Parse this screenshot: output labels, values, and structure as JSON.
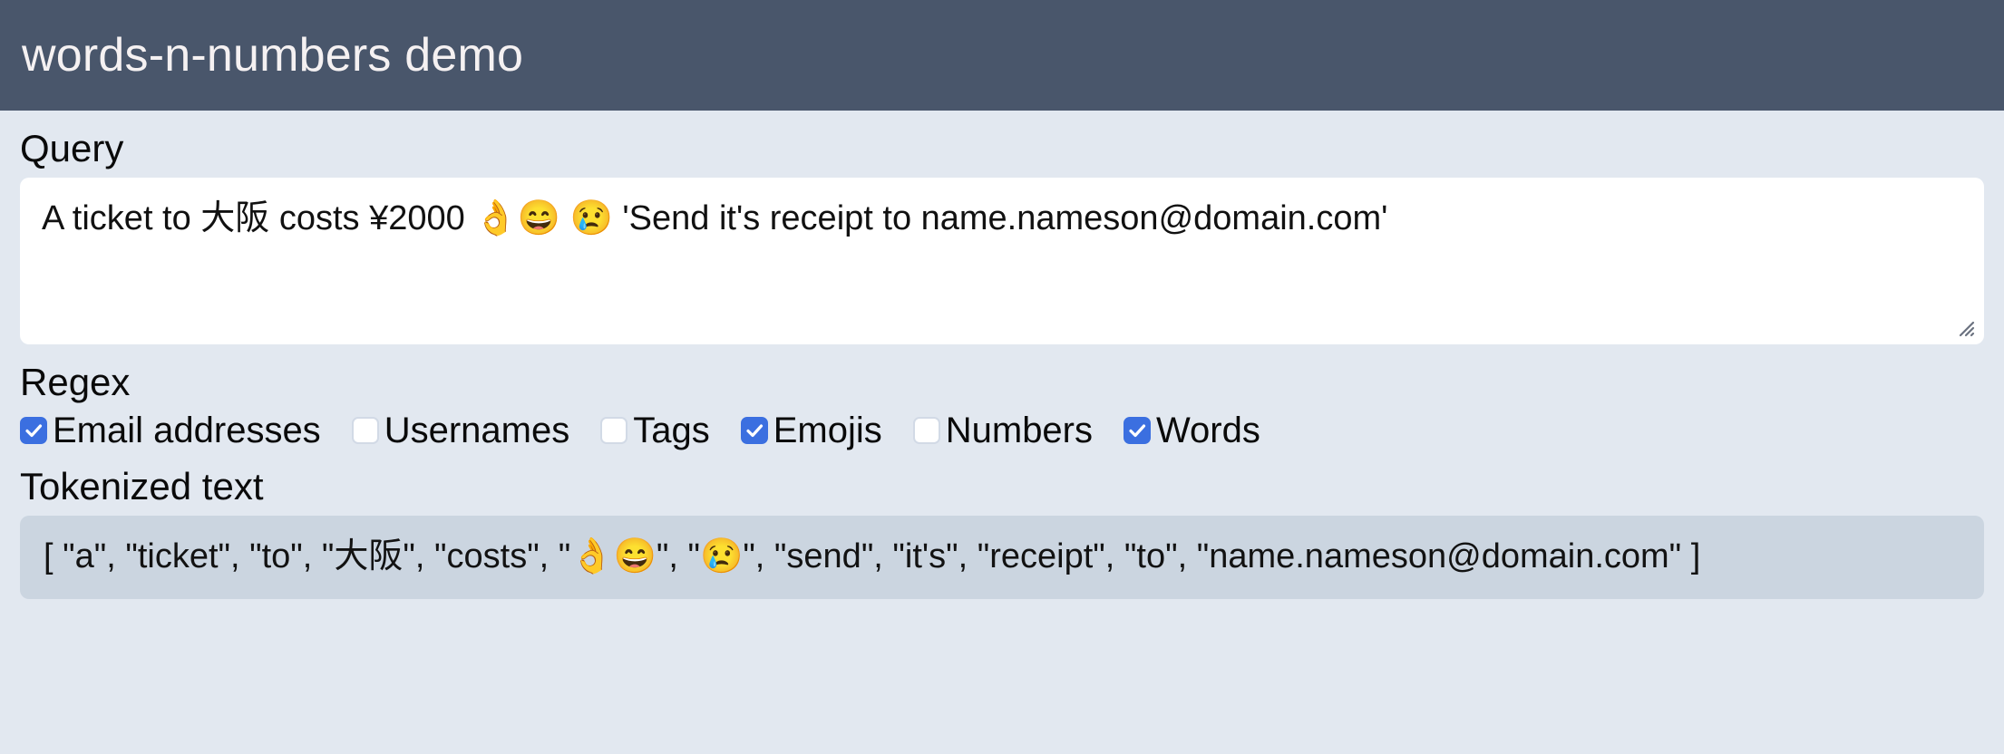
{
  "header": {
    "title": "words-n-numbers demo",
    "background_color": "#49566b",
    "text_color": "#f5f1f2"
  },
  "theme": {
    "page_background": "#e2e8f0",
    "accent_color": "#3b6fe0",
    "output_background": "#cbd5e0",
    "input_background": "#ffffff"
  },
  "query": {
    "label": "Query",
    "value": "A ticket to 大阪 costs ¥2000 👌😄 😢 'Send it's receipt to name.nameson@domain.com'",
    "placeholder": "Type a query..."
  },
  "regex": {
    "label": "Regex",
    "options": [
      {
        "label": "Email addresses",
        "checked": true
      },
      {
        "label": "Usernames",
        "checked": false
      },
      {
        "label": "Tags",
        "checked": false
      },
      {
        "label": "Emojis",
        "checked": true
      },
      {
        "label": "Numbers",
        "checked": false
      },
      {
        "label": "Words",
        "checked": true
      }
    ]
  },
  "tokenized": {
    "label": "Tokenized text",
    "text": "[ \"a\", \"ticket\", \"to\", \"大阪\", \"costs\", \"👌😄\", \"😢\", \"send\", \"it's\", \"receipt\", \"to\", \"name.nameson@domain.com\" ]",
    "tokens": [
      "a",
      "ticket",
      "to",
      "大阪",
      "costs",
      "👌😄",
      "😢",
      "send",
      "it's",
      "receipt",
      "to",
      "name.nameson@domain.com"
    ]
  }
}
